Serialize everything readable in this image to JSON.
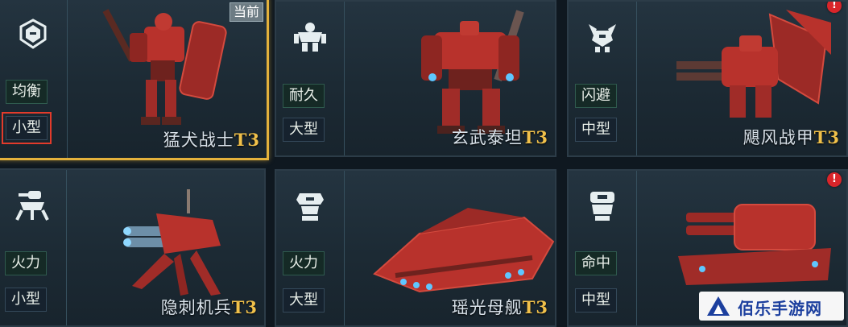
{
  "mechs": [
    {
      "role": "均衡",
      "size": "小型",
      "name": "猛犬战士",
      "tier": "T3",
      "role_icon": "balanced-class-icon",
      "current_label": "当前"
    },
    {
      "role": "耐久",
      "size": "大型",
      "name": "玄武泰坦",
      "tier": "T3",
      "role_icon": "durable-class-icon"
    },
    {
      "role": "闪避",
      "size": "中型",
      "name": "飓风战甲",
      "tier": "T3",
      "role_icon": "evasion-class-icon"
    },
    {
      "role": "火力",
      "size": "小型",
      "name": "隐刺机兵",
      "tier": "T3",
      "role_icon": "firepower-class-icon"
    },
    {
      "role": "火力",
      "size": "大型",
      "name": "瑶光母舰",
      "tier": "T3",
      "role_icon": "firepower-heavy-class-icon"
    },
    {
      "role": "命中",
      "size": "中型",
      "name": "",
      "tier": "",
      "role_icon": "accuracy-class-icon"
    }
  ],
  "alerts": [
    "!",
    "!"
  ],
  "colors": {
    "selected_border": "#e3b13c",
    "tier_text": "#f0c04a",
    "highlight_box": "#e23b2b",
    "alert": "#d9252a",
    "mech_red": "#b8322c"
  },
  "watermark": {
    "text": "佰乐手游网",
    "logo_icon": "triangle-logo-icon"
  }
}
